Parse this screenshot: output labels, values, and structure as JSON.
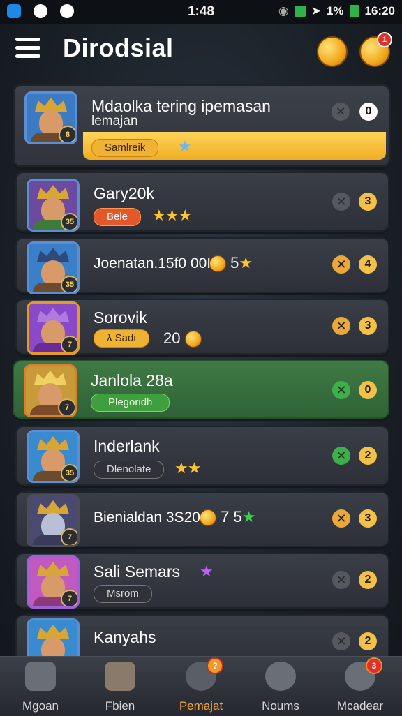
{
  "status_bar": {
    "time": "1:48",
    "battery": "1%",
    "signal_text": "16:20"
  },
  "header": {
    "title": "Dirodsial",
    "notification_count": "1"
  },
  "rows": [
    {
      "name": "Mdaolka tering ipemasan",
      "sub": "lemajan",
      "pill": "Samlreik",
      "level": "8",
      "action_number": "0"
    },
    {
      "name": "Gary20k",
      "pill": "Bele",
      "stars": "★★★",
      "level": "35",
      "action_number": "3"
    },
    {
      "name": "Joenatan.15f0 00I",
      "tail": "5",
      "tail_star": "★",
      "level": "35",
      "action_number": "4"
    },
    {
      "name": "Sorovik",
      "pill": "λ Sadi",
      "tail": "20",
      "level": "7",
      "action_number": "3"
    },
    {
      "name": "Janlola 28a",
      "pill": "Plegoridh",
      "level": "7",
      "action_number": "0"
    },
    {
      "name": "Inderlank",
      "pill": "Dlenolate",
      "stars": "★★",
      "level": "35",
      "action_number": "2"
    },
    {
      "name": "Bienialdan 3S20",
      "tail": "7 5",
      "tail_star": "★",
      "level": "7",
      "action_number": "3"
    },
    {
      "name": "Sali  Semars",
      "pill": "Msrom",
      "level": "7",
      "action_number": "2"
    },
    {
      "name": "Kanyahs",
      "level": "",
      "action_number": "2"
    }
  ],
  "bottom_nav": [
    {
      "label": "Mgoan",
      "badge": ""
    },
    {
      "label": "Fbien",
      "badge": ""
    },
    {
      "label": "Pemajat",
      "badge": "?"
    },
    {
      "label": "Noums",
      "badge": ""
    },
    {
      "label": "Mcadear",
      "badge": "3"
    }
  ],
  "colors": {
    "accent": "#f5a43a",
    "highlight_row": "#3f7a45",
    "featured_bar": "#f0ae22"
  }
}
